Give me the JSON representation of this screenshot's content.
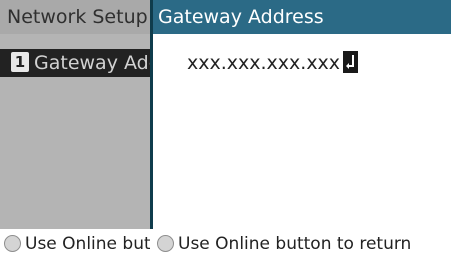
{
  "background_screen": {
    "title": "Network Setup",
    "item_number": "1",
    "item_label": "Gateway Address",
    "footer_text": "Use Online button to return"
  },
  "dialog": {
    "title": "Gateway Address",
    "value": "xxx.xxx.xxx.xxx",
    "footer_text": "Use Online button to return"
  },
  "icons": {
    "online_button": "circle-icon",
    "enter": "enter-return-icon"
  },
  "colors": {
    "dialog_header": "#2b6a86",
    "back_header": "#a9a9a9",
    "selected_item": "#222222"
  }
}
